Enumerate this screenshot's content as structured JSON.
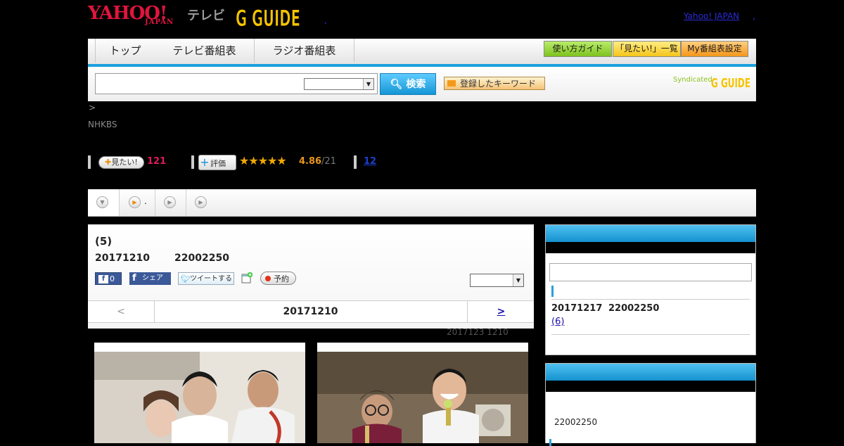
{
  "header": {
    "logo_yahoo": "YAHOO!",
    "logo_japan": "JAPAN",
    "logo_tv": "テレビ",
    "logo_gguide": "G GUIDE",
    "link_yahoo_japan": "Yahoo! JAPAN",
    "comma": ",",
    "dot": ","
  },
  "nav": {
    "tabs": [
      "トップ",
      "テレビ番組表",
      "ラジオ番組表"
    ],
    "guide_button": "使い方ガイド",
    "mitai_list_button": "「見たい!」一覧",
    "my_schedule_button": "My番組表設定"
  },
  "search": {
    "search_button": "検索",
    "keyword_button": "登録したキーワード",
    "syndicated": "Syndicated",
    "syndicated_logo": "G GUIDE"
  },
  "breadcrumb": {
    "separator": ">",
    "channel": "NHKBS"
  },
  "stats": {
    "mitai_badge": "見たい!",
    "mitai_count": "121",
    "rating_badge": "評価",
    "rating_stars": "★★★★★",
    "rating": 4.86,
    "rating_value": "4.86",
    "rating_count": "/21",
    "review_count": "12"
  },
  "tabs": {
    "tab2_label": "."
  },
  "program": {
    "episode_title": "(5)",
    "air_date": "20171210",
    "air_time": "22002250",
    "like_count": "0",
    "share_label": "シェア",
    "tweet_label": "ツイートする",
    "reserve_label": "予約",
    "prev_label": "<",
    "nav_date": "20171210",
    "next_label": ">",
    "update_info": "2017123  1210"
  },
  "sidebar": {
    "next_air_date": "20171217",
    "next_air_time": "22002250",
    "next_episode_link": "(6)",
    "box2_time": "22002250"
  },
  "colors": {
    "accent_blue": "#1aa0de",
    "yahoo_red": "#e0153d",
    "mitai_pink": "#e2195e",
    "rating_orange": "#e8961a"
  }
}
